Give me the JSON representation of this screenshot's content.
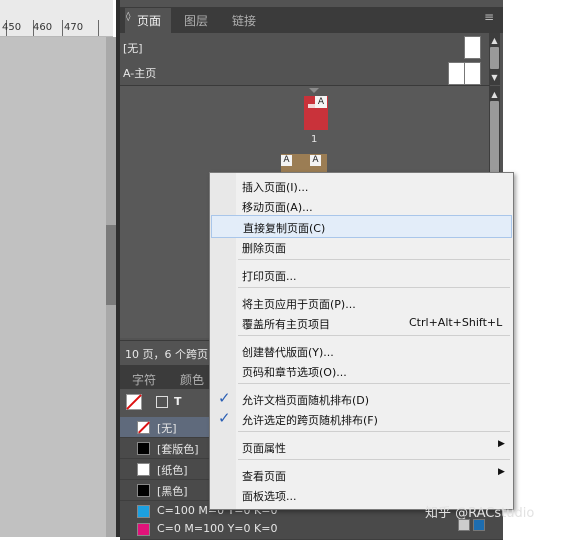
{
  "ruler": {
    "labels": [
      "450",
      "460",
      "470"
    ]
  },
  "panel": {
    "tabs": [
      "页面",
      "图层",
      "链接"
    ],
    "tab_prefix": "◊",
    "masters": [
      "[无]",
      "A-主页"
    ],
    "page1": {
      "label": "A",
      "number": "1"
    },
    "page2": {
      "labels": [
        "A",
        "A"
      ]
    },
    "status": "10 页，6 个跨页"
  },
  "swatches_panel": {
    "tabs": [
      "字符",
      "颜色"
    ],
    "rows": [
      {
        "name": "[无]",
        "color": "#ffffff",
        "none": true
      },
      {
        "name": "[套版色]",
        "color": "#000000"
      },
      {
        "name": "[纸色]",
        "color": "#ffffff"
      },
      {
        "name": "[黑色]",
        "color": "#000000"
      },
      {
        "name": "C=100 M=0 Y=0 K=0",
        "color": "#1da0e0"
      },
      {
        "name": "C=0 M=100 Y=0 K=0",
        "color": "#e0127a"
      }
    ],
    "tool_t": "T"
  },
  "menu": {
    "items": [
      {
        "label": "插入页面(I)..."
      },
      {
        "label": "移动页面(A)..."
      },
      {
        "label": "直接复制页面(C)"
      },
      {
        "label": "删除页面"
      },
      {
        "label": "打印页面..."
      },
      {
        "label": "将主页应用于页面(P)..."
      },
      {
        "label": "覆盖所有主页项目",
        "shortcut": "Ctrl+Alt+Shift+L"
      },
      {
        "label": "创建替代版面(Y)..."
      },
      {
        "label": "页码和章节选项(O)..."
      },
      {
        "label": "允许文档页面随机排布(D)",
        "check": "✓"
      },
      {
        "label": "允许选定的跨页随机排布(F)",
        "check": "✓"
      },
      {
        "label": "页面属性",
        "submenu": "▶"
      },
      {
        "label": "查看页面",
        "submenu": "▶"
      },
      {
        "label": "面板选项..."
      }
    ]
  },
  "watermark": "知乎 @RACstudio",
  "colors": {
    "accent": "#2b5fb4",
    "highlight": "#e3edf9",
    "page_red": "#c9323a"
  }
}
